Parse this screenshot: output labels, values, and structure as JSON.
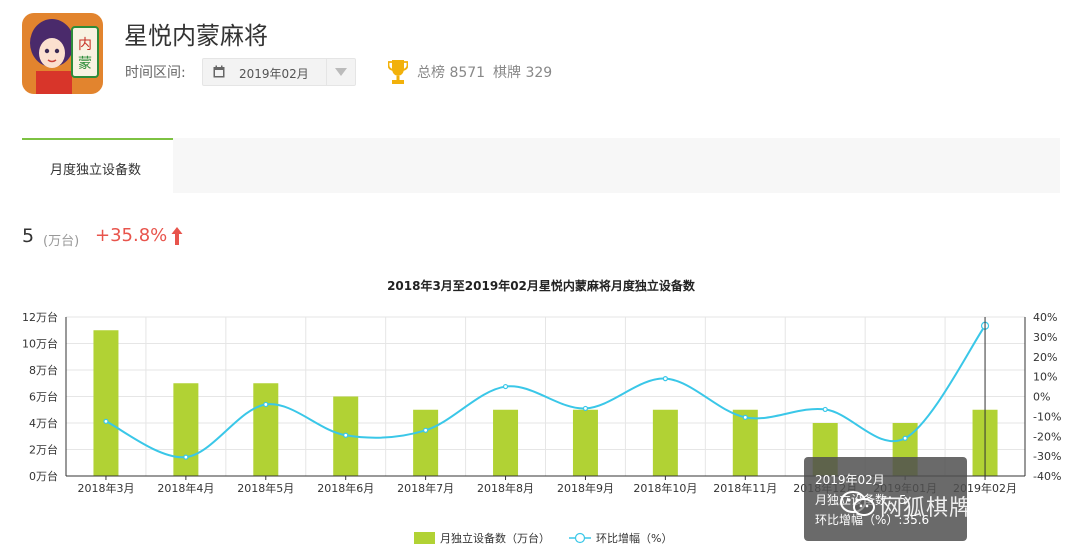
{
  "app": {
    "title": "星悦内蒙麻将",
    "icon": "mahjong-app-icon"
  },
  "filter": {
    "label": "时间区间:",
    "date_value": "2019年02月"
  },
  "ranking": {
    "total_label": "总榜 8571",
    "category_label": "棋牌 329"
  },
  "tabs": [
    {
      "label": "月度独立设备数",
      "active": true
    }
  ],
  "metric": {
    "value": "5",
    "unit": "(万台)",
    "change": "+35.8%"
  },
  "colors": {
    "accent": "#7dc242",
    "bar": "#b1d234",
    "line": "#3ac7e8",
    "up": "#e8544c"
  },
  "tooltip": {
    "title": "2019年02月",
    "line1": "月独立设备数：5",
    "line2": "环比增幅（%）:35.6"
  },
  "watermark": "网狐棋牌开发",
  "chart_data": {
    "type": "bar",
    "title": "2018年3月至2019年02月星悦内蒙麻将月度独立设备数",
    "categories": [
      "2018年3月",
      "2018年4月",
      "2018年5月",
      "2018年6月",
      "2018年7月",
      "2018年8月",
      "2018年9月",
      "2018年10月",
      "2018年11月",
      "2018年12月",
      "2019年01月",
      "2019年02月"
    ],
    "y_left_ticks": [
      "0万台",
      "2万台",
      "4万台",
      "6万台",
      "8万台",
      "10万台",
      "12万台"
    ],
    "y_right_ticks": [
      "-40%",
      "-30%",
      "-20%",
      "-10%",
      "0%",
      "10%",
      "20%",
      "30%",
      "40%"
    ],
    "ylim_left": [
      0,
      12
    ],
    "ylim_right": [
      -40,
      40
    ],
    "grid": true,
    "legend_position": "bottom-center",
    "series": [
      {
        "name": "月独立设备数（万台）",
        "type": "bar",
        "axis": "left",
        "values": [
          11,
          7,
          7,
          6,
          5,
          5,
          5,
          5,
          5,
          4,
          4,
          5
        ]
      },
      {
        "name": "环比增幅（%）",
        "type": "line",
        "axis": "right",
        "values": [
          -12.5,
          -30.5,
          -4,
          -19.5,
          -17,
          5,
          -6,
          9,
          -10.5,
          -6.5,
          -21,
          35.6
        ]
      }
    ]
  }
}
